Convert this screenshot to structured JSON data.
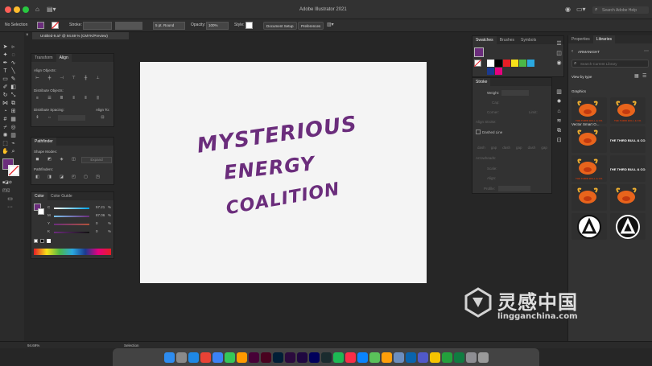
{
  "window": {
    "title": "Adobe Illustrator 2021",
    "search_placeholder": "Search Adobe Help"
  },
  "control_bar": {
    "selection": "No Selection",
    "stroke_label": "Stroke:",
    "brush": "5 pt. Round",
    "opacity_label": "Opacity:",
    "opacity_value": "100%",
    "style_label": "Style:",
    "document_setup": "Document Setup",
    "preferences": "Preferences"
  },
  "document": {
    "tab": "Untitled-9.ai* @ 94.69 % (CMYK/Preview)",
    "tooltip": "Untitled-9.ai* @ 94.69 % (CMYK/Preview)",
    "zoom": "94.69%",
    "status_tool": "Selection"
  },
  "artwork": {
    "line1": "MYSTERIOUS",
    "line2": "ENERGY",
    "line3": "COALITION",
    "color": "#6b2d7c"
  },
  "transform_panel": {
    "tabs": [
      "Transform",
      "Align"
    ],
    "align_objects": "Align Objects:",
    "distribute_objects": "Distribute Objects:",
    "distribute_spacing": "Distribute Spacing:",
    "align_to": "Align To:"
  },
  "pathfinder_panel": {
    "tab": "Pathfinder",
    "shape_modes": "Shape Modes:",
    "expand": "Expand",
    "pathfinders": "Pathfinders:"
  },
  "color_panel": {
    "tabs": [
      "Color",
      "Color Guide"
    ],
    "channels": [
      {
        "label": "C",
        "value": "57.21",
        "pct": "%"
      },
      {
        "label": "M",
        "value": "87.06",
        "pct": "%"
      },
      {
        "label": "Y",
        "value": "0",
        "pct": "%"
      },
      {
        "label": "K",
        "value": "0",
        "pct": "%"
      }
    ],
    "fill_color": "#6b2d7c"
  },
  "swatches_panel": {
    "tabs": [
      "Swatches",
      "Brushes",
      "Symbols"
    ],
    "colors": [
      "#ffffff",
      "#000000",
      "#e61e25",
      "#f7e11a",
      "#4cb847",
      "#2aa8e0",
      "#1a3a8f",
      "#e6007e"
    ]
  },
  "stroke_panel": {
    "title": "Stroke",
    "weight_label": "Weight:",
    "cap_label": "Cap:",
    "corner_label": "Corner:",
    "limit_label": "Limit:",
    "align_stroke_label": "Align Stroke:",
    "dashed_line": "Dashed Line",
    "dash_cols": [
      "dash",
      "gap",
      "dash",
      "gap",
      "dash",
      "gap"
    ],
    "arrowheads_label": "Arrowheads:",
    "scale_label": "Scale:",
    "align_label": "Align:",
    "profile_label": "Profile:"
  },
  "libraries_panel": {
    "tabs": [
      "Properties",
      "Libraries"
    ],
    "library_name": "ARMANIGHT",
    "search_placeholder": "Search Current Library",
    "view_by": "View by type",
    "section": "Graphics",
    "first_item_label": "Vector Smart O...",
    "brand_text": "THE THIRD BULL & CO."
  }
}
